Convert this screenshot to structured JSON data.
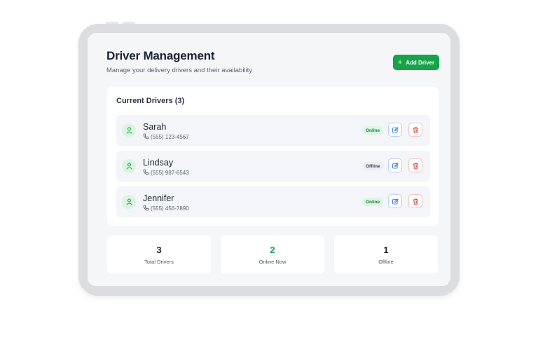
{
  "header": {
    "title": "Driver Management",
    "subtitle": "Manage your delivery drivers and their availability",
    "add_button_label": "Add Driver"
  },
  "drivers_card": {
    "title": "Current Drivers (3)",
    "drivers": [
      {
        "name": "Sarah",
        "phone": "(555) 123-4567",
        "status": "Online"
      },
      {
        "name": "Lindsay",
        "phone": "(555) 987-6543",
        "status": "Offline"
      },
      {
        "name": "Jennifer",
        "phone": "(555) 456-7890",
        "status": "Online"
      }
    ]
  },
  "stats": [
    {
      "value": "3",
      "label": "Total Drivers"
    },
    {
      "value": "2",
      "label": "Online Now"
    },
    {
      "value": "1",
      "label": "Offline"
    }
  ],
  "icons": {
    "avatar": "user-icon",
    "phone": "phone-icon",
    "edit": "edit-icon",
    "delete": "trash-icon",
    "add": "plus-icon"
  },
  "colors": {
    "accent": "#16a34a",
    "online_badge_bg": "#dcf5e4",
    "offline_badge_bg": "#eceef2",
    "edit_accent": "#2563eb",
    "delete_accent": "#dc2626"
  }
}
